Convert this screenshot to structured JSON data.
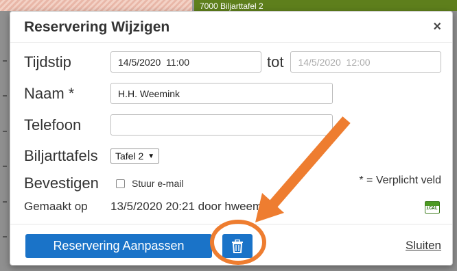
{
  "background": {
    "green_bar_text": "7000 Biljarttafel 2"
  },
  "modal": {
    "title": "Reservering Wijzigen",
    "close_glyph": "×"
  },
  "form": {
    "tijdstip_label": "Tijdstip",
    "start_value": "14/5/2020  11:00",
    "tot_label": "tot",
    "end_placeholder": "14/5/2020  12:00",
    "naam_label": "Naam *",
    "naam_value": "H.H. Weemink",
    "telefoon_label": "Telefoon",
    "telefoon_value": "",
    "biljarttafels_label": "Biljarttafels",
    "tafel_selected": "Tafel 2",
    "bevestigen_label": "Bevestigen",
    "stuur_email_label": "Stuur e-mail",
    "required_note": "* = Verplicht veld",
    "gemaakt_op_label": "Gemaakt op",
    "gemaakt_op_value": "13/5/2020 20:21 door hweemink",
    "ical_text": "iCAL"
  },
  "footer": {
    "save_label": "Reservering Aanpassen",
    "delete_icon": "trash-icon",
    "close_label": "Sluiten"
  },
  "colors": {
    "primary": "#1a73c8",
    "annotation": "#ee7d30"
  }
}
